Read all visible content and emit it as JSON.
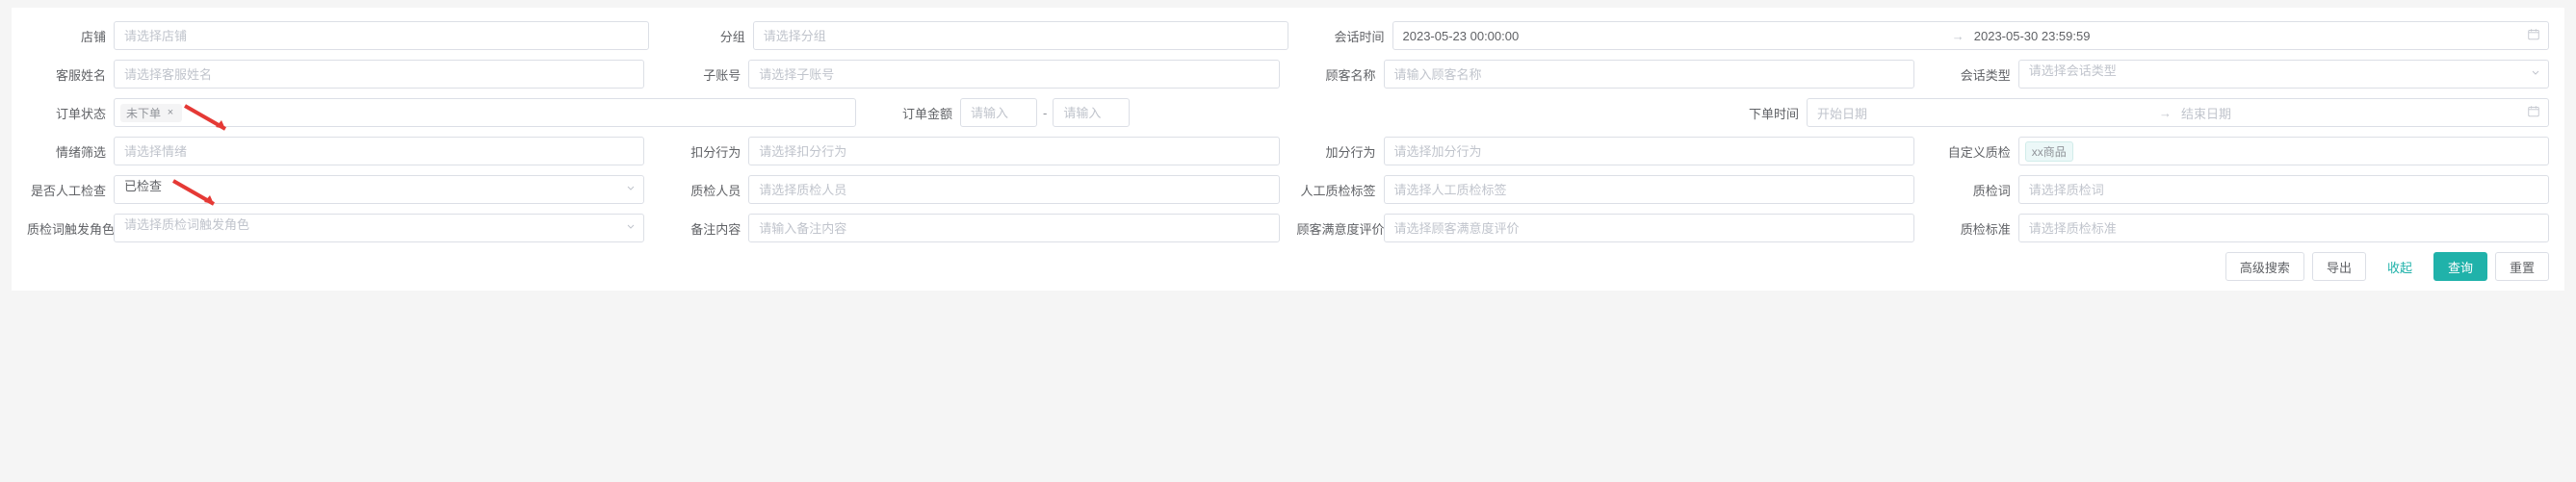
{
  "labels": {
    "shop": "店铺",
    "agent_name": "客服姓名",
    "order_status": "订单状态",
    "emotion_filter": "情绪筛选",
    "manual_check": "是否人工检查",
    "qc_role": "质检词触发角色",
    "group": "分组",
    "sub_account": "子账号",
    "order_amount": "订单金额",
    "deduct_action": "扣分行为",
    "qc_person": "质检人员",
    "remark": "备注内容",
    "session_time": "会话时间",
    "customer_name": "顾客名称",
    "order_time": "下单时间",
    "add_action": "加分行为",
    "manual_qc_tag": "人工质检标签",
    "satisfaction": "顾客满意度评价",
    "session_type": "会话类型",
    "custom_qc": "自定义质检",
    "qc_word": "质检词",
    "qc_standard": "质检标准"
  },
  "placeholders": {
    "shop": "请选择店铺",
    "agent_name": "请选择客服姓名",
    "emotion_filter": "请选择情绪",
    "qc_role": "请选择质检词触发角色",
    "group": "请选择分组",
    "sub_account": "请选择子账号",
    "amount": "请输入",
    "deduct_action": "请选择扣分行为",
    "qc_person": "请选择质检人员",
    "remark": "请输入备注内容",
    "customer_name": "请输入顾客名称",
    "start_date": "开始日期",
    "end_date": "结束日期",
    "add_action": "请选择加分行为",
    "manual_qc_tag": "请选择人工质检标签",
    "satisfaction": "请选择顾客满意度评价",
    "session_type": "请选择会话类型",
    "qc_word": "请选择质检词",
    "qc_standard": "请选择质检标准"
  },
  "values": {
    "order_status_tag": "未下单",
    "manual_check": "已检查",
    "session_start": "2023-05-23 00:00:00",
    "session_end": "2023-05-30 23:59:59",
    "custom_qc_tag": "xx商品"
  },
  "buttons": {
    "advanced": "高级搜索",
    "export": "导出",
    "collapse": "收起",
    "query": "查询",
    "reset": "重置"
  },
  "range_separator": "-",
  "date_separator": "→"
}
